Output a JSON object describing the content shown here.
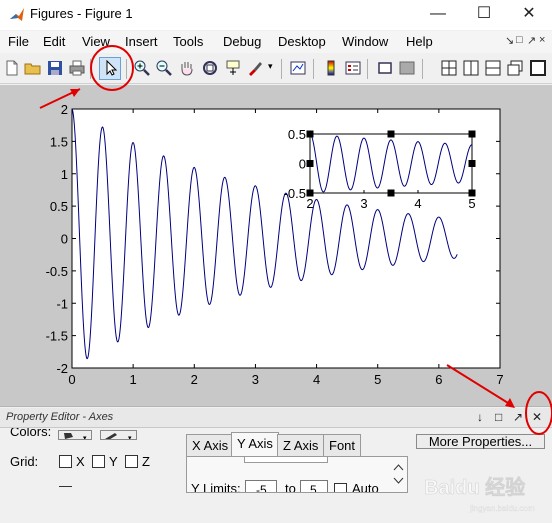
{
  "window": {
    "title": "Figures - Figure 1",
    "app_icon": "matlab-icon",
    "controls": {
      "minimize": "—",
      "maximize": "☐",
      "close": "✕"
    }
  },
  "menu": {
    "items": [
      "File",
      "Edit",
      "View",
      "Insert",
      "Tools",
      "Debug",
      "Desktop",
      "Window",
      "Help"
    ],
    "right_controls": [
      "↘",
      "□",
      "↗",
      "×"
    ]
  },
  "toolbar": {
    "buttons": [
      "new-figure-icon",
      "open-file-icon",
      "save-icon",
      "print-icon",
      "select-arrow-icon",
      "zoom-in-icon",
      "zoom-out-icon",
      "pan-hand-icon",
      "rotate-3d-icon",
      "data-cursor-icon",
      "brush-icon",
      "link-plot-icon",
      "colorbar-icon",
      "legend-icon",
      "hide-plot-tools-icon",
      "show-plot-tools-icon",
      "tile-2x2-icon",
      "tile-left-right-icon",
      "tile-top-bottom-icon",
      "float-icon",
      "maximize-icon"
    ]
  },
  "chart_data": [
    {
      "type": "line",
      "function": "2*exp(-0.3x)*cos(2*pi*2x)",
      "x_range": [
        0,
        6.3
      ],
      "xlim": [
        0,
        7
      ],
      "ylim": [
        -2,
        2
      ],
      "xticks": [
        "0",
        "1",
        "2",
        "3",
        "4",
        "5",
        "6",
        "7"
      ],
      "yticks": [
        "2",
        "1.5",
        "1",
        "0.5",
        "0",
        "-0.5",
        "-1",
        "-1.5",
        "-2"
      ],
      "color": "#00007f",
      "grid": false
    },
    {
      "type": "line",
      "function": "0.5*exp(-0.15x)*cos(2*pi*2x)",
      "x_range": [
        2,
        5
      ],
      "xlim": [
        2,
        5
      ],
      "ylim": [
        -0.5,
        0.5
      ],
      "xticks": [
        "2",
        "3",
        "4",
        "5"
      ],
      "yticks": [
        "0.5",
        "0",
        "-0.5"
      ],
      "color": "#00007f",
      "grid": false,
      "selected": true
    }
  ],
  "property_editor": {
    "title": "Property Editor - Axes",
    "header_buttons": [
      "↓",
      "□",
      "↗",
      "✕"
    ],
    "colors_label": "Colors:",
    "grid_label": "Grid:",
    "grid_options": [
      "X",
      "Y",
      "Z"
    ],
    "tabs": [
      "X Axis",
      "Y Axis",
      "Z Axis",
      "Font"
    ],
    "active_tab": "Y Axis",
    "more_properties": "More Properties...",
    "y_limits_label": "Y Limits:",
    "y_limits_to": "to",
    "y_limits_values": [
      "-5",
      "5"
    ],
    "auto_label": "Auto"
  },
  "annotations": {
    "color": "#e00000",
    "watermark": "Baidu 经验",
    "watermark_sub": "jingyan.baidu.com"
  }
}
